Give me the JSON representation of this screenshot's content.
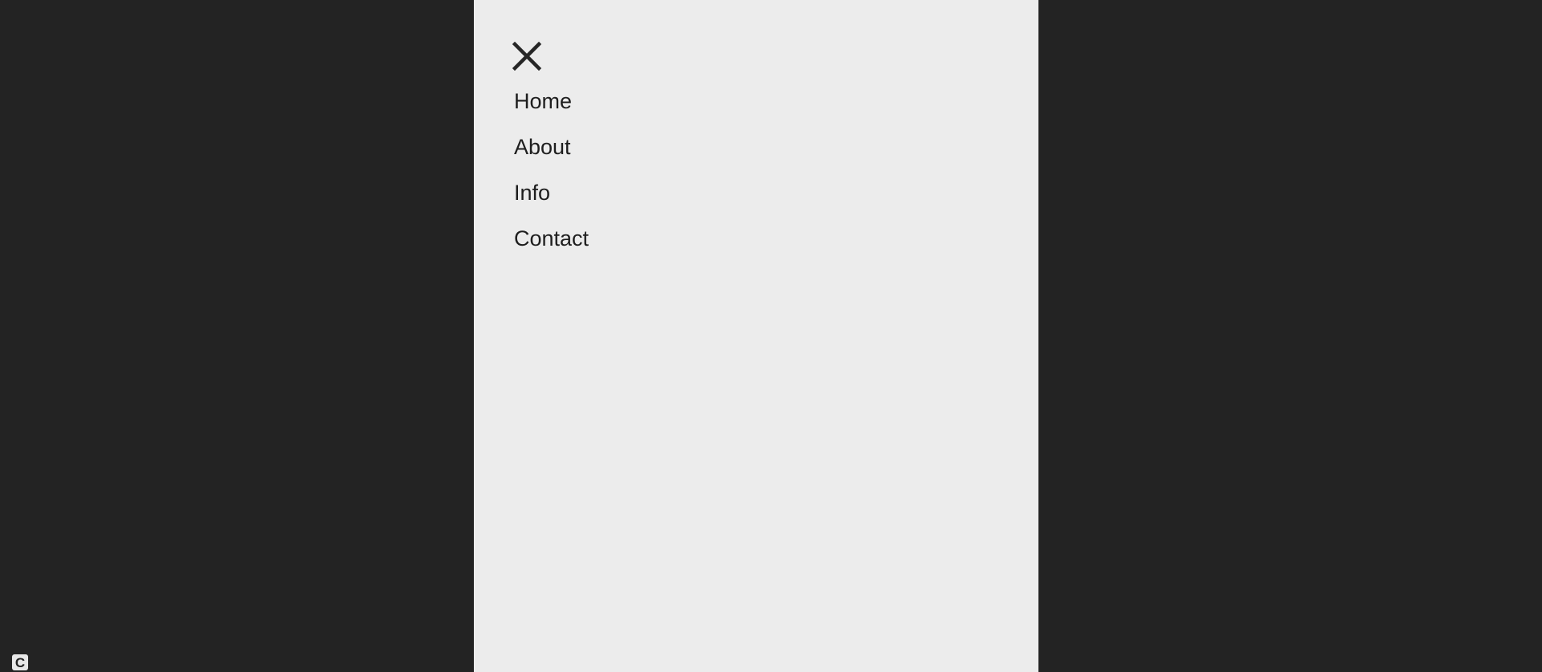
{
  "menu": {
    "close_icon": "close-icon",
    "items": [
      {
        "label": "Home"
      },
      {
        "label": "About"
      },
      {
        "label": "Info"
      },
      {
        "label": "Contact"
      }
    ]
  },
  "badge": {
    "label": "C"
  },
  "colors": {
    "background": "#232323",
    "panel": "#ececec",
    "text": "#1e1e1e"
  }
}
